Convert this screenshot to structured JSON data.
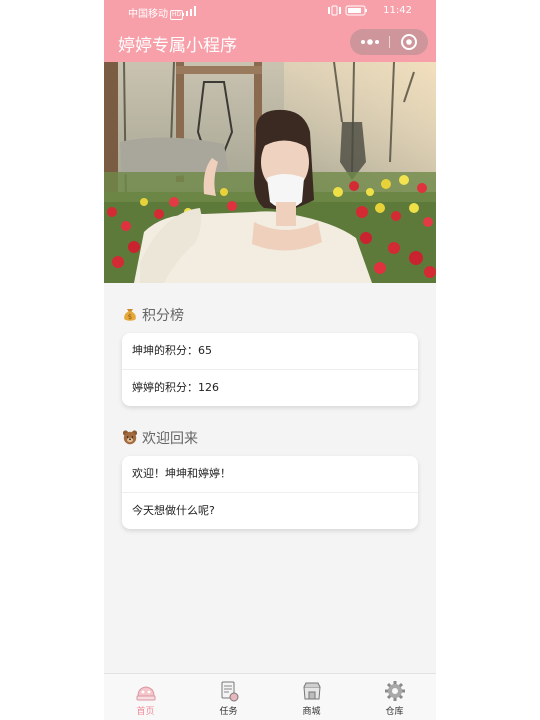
{
  "status_bar": {
    "carrier": "中国移动",
    "carrier_badge": "HD",
    "time": "11:42"
  },
  "title_bar": {
    "title": "婷婷专属小程序"
  },
  "colors": {
    "accent_pink": "#f7a0aa",
    "background": "#f4f4f4",
    "active_tab": "#f08c9a"
  },
  "banner": {
    "slide_count": 3,
    "active_slide": 1
  },
  "points_section": {
    "icon": "money-bag-icon",
    "title": "积分榜",
    "rows": [
      {
        "label": "坤坤的积分：",
        "value": "65"
      },
      {
        "label": "婷婷的积分：",
        "value": "126"
      }
    ]
  },
  "welcome_section": {
    "icon": "bear-icon",
    "title": "欢迎回来",
    "rows": [
      {
        "text": "欢迎！坤坤和婷婷！"
      },
      {
        "text": "今天想做什么呢?"
      }
    ]
  },
  "tab_bar": {
    "tabs": [
      {
        "label": "首页",
        "icon": "home-icon",
        "active": true
      },
      {
        "label": "任务",
        "icon": "task-icon",
        "active": false
      },
      {
        "label": "商城",
        "icon": "shop-icon",
        "active": false
      },
      {
        "label": "仓库",
        "icon": "gear-icon",
        "active": false
      }
    ]
  }
}
